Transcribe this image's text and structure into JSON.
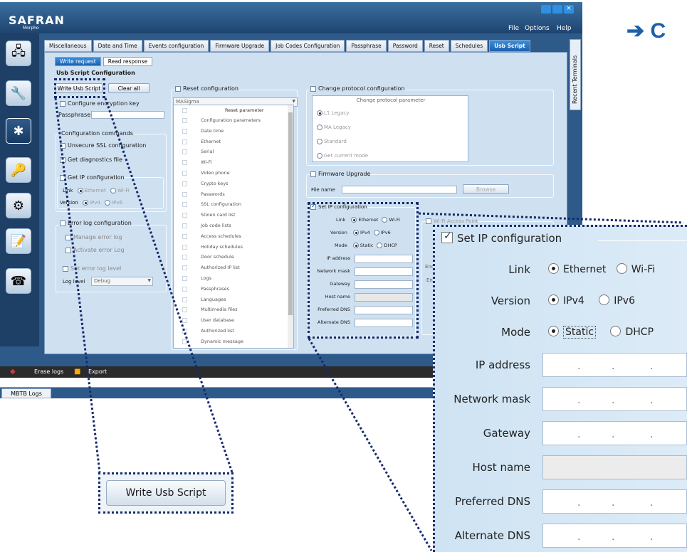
{
  "app": {
    "logo": "SAFRAN",
    "logo_sub": "Morpho",
    "menu": [
      "File",
      "Options",
      "Help"
    ]
  },
  "right_header": "➔ C",
  "tabs": [
    "Miscellaneous",
    "Date and Time",
    "Events configuration",
    "Firmware Upgrade",
    "Job Codes Configuration",
    "Passphrase",
    "Password",
    "Reset",
    "Schedules",
    "Usb Script"
  ],
  "side_tab": "Recent Terminals",
  "subtabs": [
    "Write request",
    "Read response"
  ],
  "panel_title": "Usb Script Configuration",
  "buttons": {
    "write": "Write Usb Script",
    "clear": "Clear all",
    "browse": "Browse"
  },
  "encryption": {
    "label": "Configure encryption key",
    "passphrase": "Passphrase"
  },
  "config_commands": {
    "title": "Configuration commands",
    "items": [
      "Unsecure SSL configuration",
      "Get diagnostics file",
      "Get IP configuration"
    ],
    "link_label": "Link",
    "link_options": [
      "Ethernet",
      "Wi-Fi"
    ],
    "version_label": "Version",
    "version_options": [
      "IPv4",
      "IPv6"
    ]
  },
  "error_log": {
    "title": "Error log configuration",
    "items": [
      "Manage error log",
      "Activate error Log",
      "Set error log level"
    ],
    "level_label": "Log level",
    "level_value": "Debug"
  },
  "reset": {
    "title": "Reset configuration",
    "dropdown": "MASigma",
    "header": "Reset parameter",
    "items": [
      "Configuration parameters",
      "Date time",
      "Ethernet",
      "Serial",
      "Wi-Fi",
      "Video phone",
      "Crypto keys",
      "Passwords",
      "SSL configuration",
      "Stolen card list",
      "Job code lists",
      "Access schedules",
      "Holiday schedules",
      "Door schedule",
      "Authorized IP list",
      "Logs",
      "Passphrases",
      "Languages",
      "Multimedia files",
      "User database",
      "Authorized list",
      "Dynamic message"
    ]
  },
  "protocol": {
    "title": "Change protocol configuration",
    "header": "Change protocol parameter",
    "options": [
      "L1 Legacy",
      "MA Legacy",
      "Standard",
      "Get current mode"
    ]
  },
  "firmware": {
    "title": "Firmware Upgrade",
    "file_label": "File name"
  },
  "set_ip": {
    "title": "Set IP configuration",
    "link_label": "Link",
    "link_options": [
      "Ethernet",
      "Wi-Fi"
    ],
    "version_label": "Version",
    "version_options": [
      "IPv4",
      "IPv6"
    ],
    "mode_label": "Mode",
    "mode_options": [
      "Static",
      "DHCP"
    ],
    "fields": [
      "IP address",
      "Network mask",
      "Gateway",
      "Host name",
      "Preferred DNS",
      "Alternate DNS"
    ]
  },
  "wifi": {
    "title": "Wi-Fi Access Point",
    "labels": [
      "Enc",
      "En"
    ]
  },
  "bottom": {
    "erase": "Erase logs",
    "export": "Export",
    "logs_tab": "MBTB Logs"
  },
  "colors": {
    "accent": "#1b61b0",
    "panel": "#cfe1f1",
    "dotted": "#142a6b"
  }
}
